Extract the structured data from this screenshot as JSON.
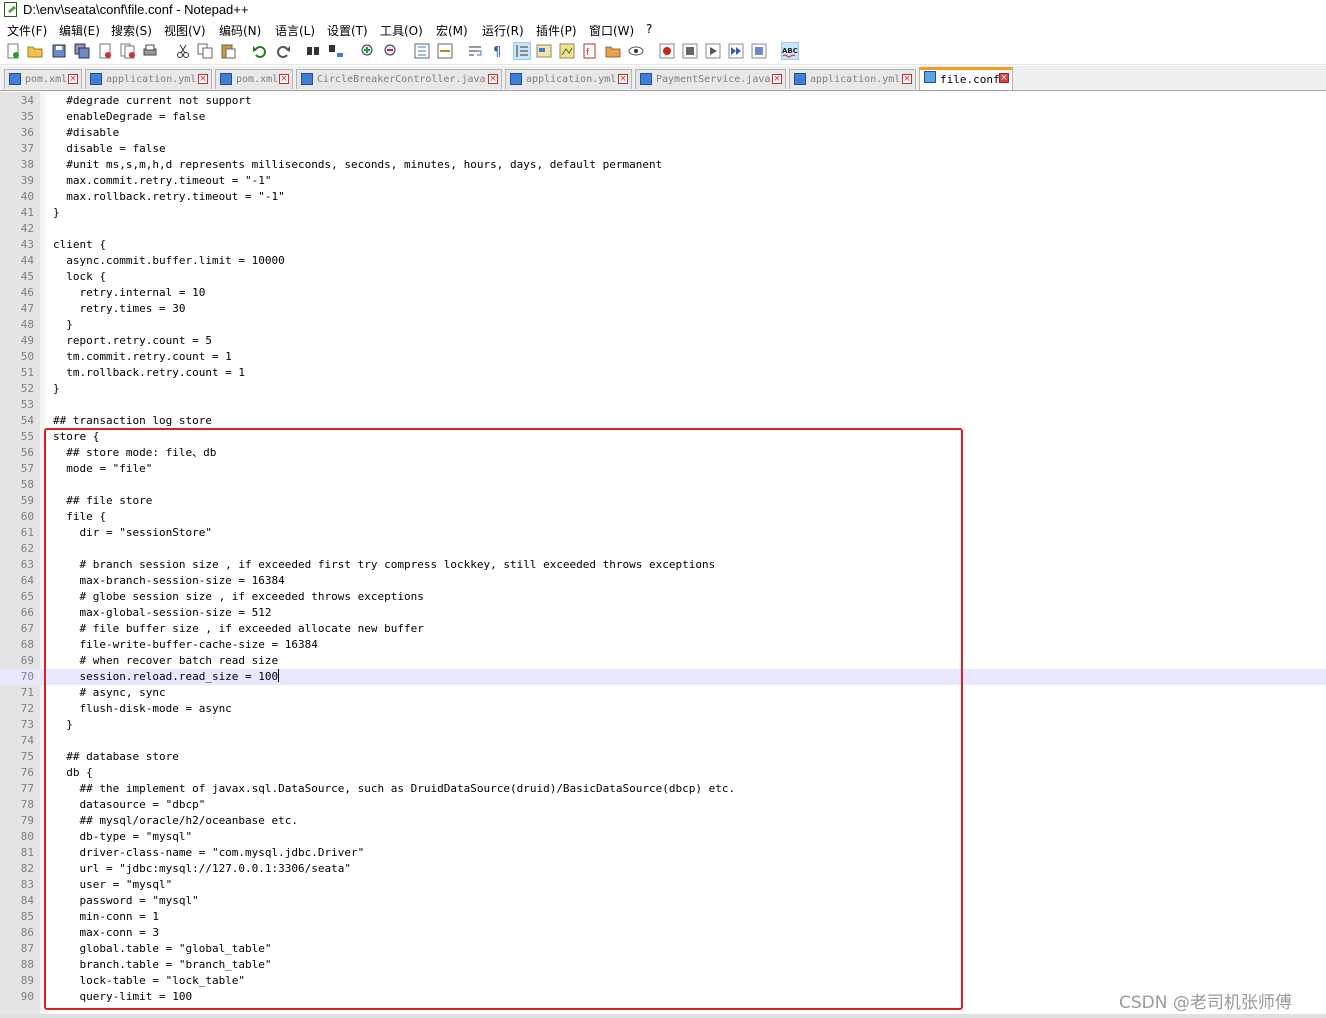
{
  "window": {
    "title": "D:\\env\\seata\\conf\\file.conf - Notepad++"
  },
  "menubar": {
    "items": [
      "文件(F)",
      "编辑(E)",
      "搜索(S)",
      "视图(V)",
      "编码(N)",
      "语言(L)",
      "设置(T)",
      "工具(O)",
      "宏(M)",
      "运行(R)",
      "插件(P)",
      "窗口(W)",
      "?"
    ]
  },
  "toolbar": {
    "icons": [
      "new-file-icon",
      "open-file-icon",
      "save-icon",
      "save-all-icon",
      "close-icon",
      "close-all-icon",
      "print-icon",
      "cut-icon",
      "copy-icon",
      "paste-icon",
      "undo-icon",
      "redo-icon",
      "find-icon",
      "replace-icon",
      "zoom-in-icon",
      "zoom-out-icon",
      "sync-vertical-icon",
      "sync-horizontal-icon",
      "word-wrap-icon",
      "show-all-chars-icon",
      "indent-guide-icon",
      "user-language-icon",
      "doc-map-icon",
      "function-list-icon",
      "folder-workspace-icon",
      "monitoring-icon",
      "record-macro-icon",
      "stop-record-icon",
      "play-macro-icon",
      "run-macro-multiple-icon",
      "save-macro-icon",
      "spell-check-icon"
    ]
  },
  "tabs": [
    {
      "label": "pom.xml",
      "active": false
    },
    {
      "label": "application.yml",
      "active": false
    },
    {
      "label": "pom.xml",
      "active": false
    },
    {
      "label": "CircleBreakerController.java",
      "active": false
    },
    {
      "label": "application.yml",
      "active": false
    },
    {
      "label": "PaymentService.java",
      "active": false
    },
    {
      "label": "application.yml",
      "active": false
    },
    {
      "label": "file.conf",
      "active": true
    }
  ],
  "editor": {
    "current_line": 70,
    "lines": [
      {
        "n": "34",
        "t": "  #degrade current not support"
      },
      {
        "n": "35",
        "t": "  enableDegrade = false"
      },
      {
        "n": "36",
        "t": "  #disable"
      },
      {
        "n": "37",
        "t": "  disable = false"
      },
      {
        "n": "38",
        "t": "  #unit ms,s,m,h,d represents milliseconds, seconds, minutes, hours, days, default permanent"
      },
      {
        "n": "39",
        "t": "  max.commit.retry.timeout = \"-1\""
      },
      {
        "n": "40",
        "t": "  max.rollback.retry.timeout = \"-1\""
      },
      {
        "n": "41",
        "t": "}"
      },
      {
        "n": "42",
        "t": ""
      },
      {
        "n": "43",
        "t": "client {"
      },
      {
        "n": "44",
        "t": "  async.commit.buffer.limit = 10000"
      },
      {
        "n": "45",
        "t": "  lock {"
      },
      {
        "n": "46",
        "t": "    retry.internal = 10"
      },
      {
        "n": "47",
        "t": "    retry.times = 30"
      },
      {
        "n": "48",
        "t": "  }"
      },
      {
        "n": "49",
        "t": "  report.retry.count = 5"
      },
      {
        "n": "50",
        "t": "  tm.commit.retry.count = 1"
      },
      {
        "n": "51",
        "t": "  tm.rollback.retry.count = 1"
      },
      {
        "n": "52",
        "t": "}"
      },
      {
        "n": "53",
        "t": ""
      },
      {
        "n": "54",
        "t": "## transaction log store"
      },
      {
        "n": "55",
        "t": "store {"
      },
      {
        "n": "56",
        "t": "  ## store mode: file、db"
      },
      {
        "n": "57",
        "t": "  mode = \"file\""
      },
      {
        "n": "58",
        "t": ""
      },
      {
        "n": "59",
        "t": "  ## file store"
      },
      {
        "n": "60",
        "t": "  file {"
      },
      {
        "n": "61",
        "t": "    dir = \"sessionStore\""
      },
      {
        "n": "62",
        "t": ""
      },
      {
        "n": "63",
        "t": "    # branch session size , if exceeded first try compress lockkey, still exceeded throws exceptions"
      },
      {
        "n": "64",
        "t": "    max-branch-session-size = 16384"
      },
      {
        "n": "65",
        "t": "    # globe session size , if exceeded throws exceptions"
      },
      {
        "n": "66",
        "t": "    max-global-session-size = 512"
      },
      {
        "n": "67",
        "t": "    # file buffer size , if exceeded allocate new buffer"
      },
      {
        "n": "68",
        "t": "    file-write-buffer-cache-size = 16384"
      },
      {
        "n": "69",
        "t": "    # when recover batch read size"
      },
      {
        "n": "70",
        "t": "    session.reload.read_size = 100"
      },
      {
        "n": "71",
        "t": "    # async, sync"
      },
      {
        "n": "72",
        "t": "    flush-disk-mode = async"
      },
      {
        "n": "73",
        "t": "  }"
      },
      {
        "n": "74",
        "t": ""
      },
      {
        "n": "75",
        "t": "  ## database store"
      },
      {
        "n": "76",
        "t": "  db {"
      },
      {
        "n": "77",
        "t": "    ## the implement of javax.sql.DataSource, such as DruidDataSource(druid)/BasicDataSource(dbcp) etc."
      },
      {
        "n": "78",
        "t": "    datasource = \"dbcp\""
      },
      {
        "n": "79",
        "t": "    ## mysql/oracle/h2/oceanbase etc."
      },
      {
        "n": "80",
        "t": "    db-type = \"mysql\""
      },
      {
        "n": "81",
        "t": "    driver-class-name = \"com.mysql.jdbc.Driver\""
      },
      {
        "n": "82",
        "t": "    url = \"jdbc:mysql://127.0.0.1:3306/seata\""
      },
      {
        "n": "83",
        "t": "    user = \"mysql\""
      },
      {
        "n": "84",
        "t": "    password = \"mysql\""
      },
      {
        "n": "85",
        "t": "    min-conn = 1"
      },
      {
        "n": "86",
        "t": "    max-conn = 3"
      },
      {
        "n": "87",
        "t": "    global.table = \"global_table\""
      },
      {
        "n": "88",
        "t": "    branch.table = \"branch_table\""
      },
      {
        "n": "89",
        "t": "    lock-table = \"lock_table\""
      },
      {
        "n": "90",
        "t": "    query-limit = 100"
      }
    ]
  },
  "watermark": "CSDN @老司机张师傅",
  "colors": {
    "highlight_box": "#e02020",
    "active_tab_accent": "#fa9a1e",
    "current_line_bg": "#e8e8ff",
    "gutter_bg": "#e4e4e4"
  }
}
